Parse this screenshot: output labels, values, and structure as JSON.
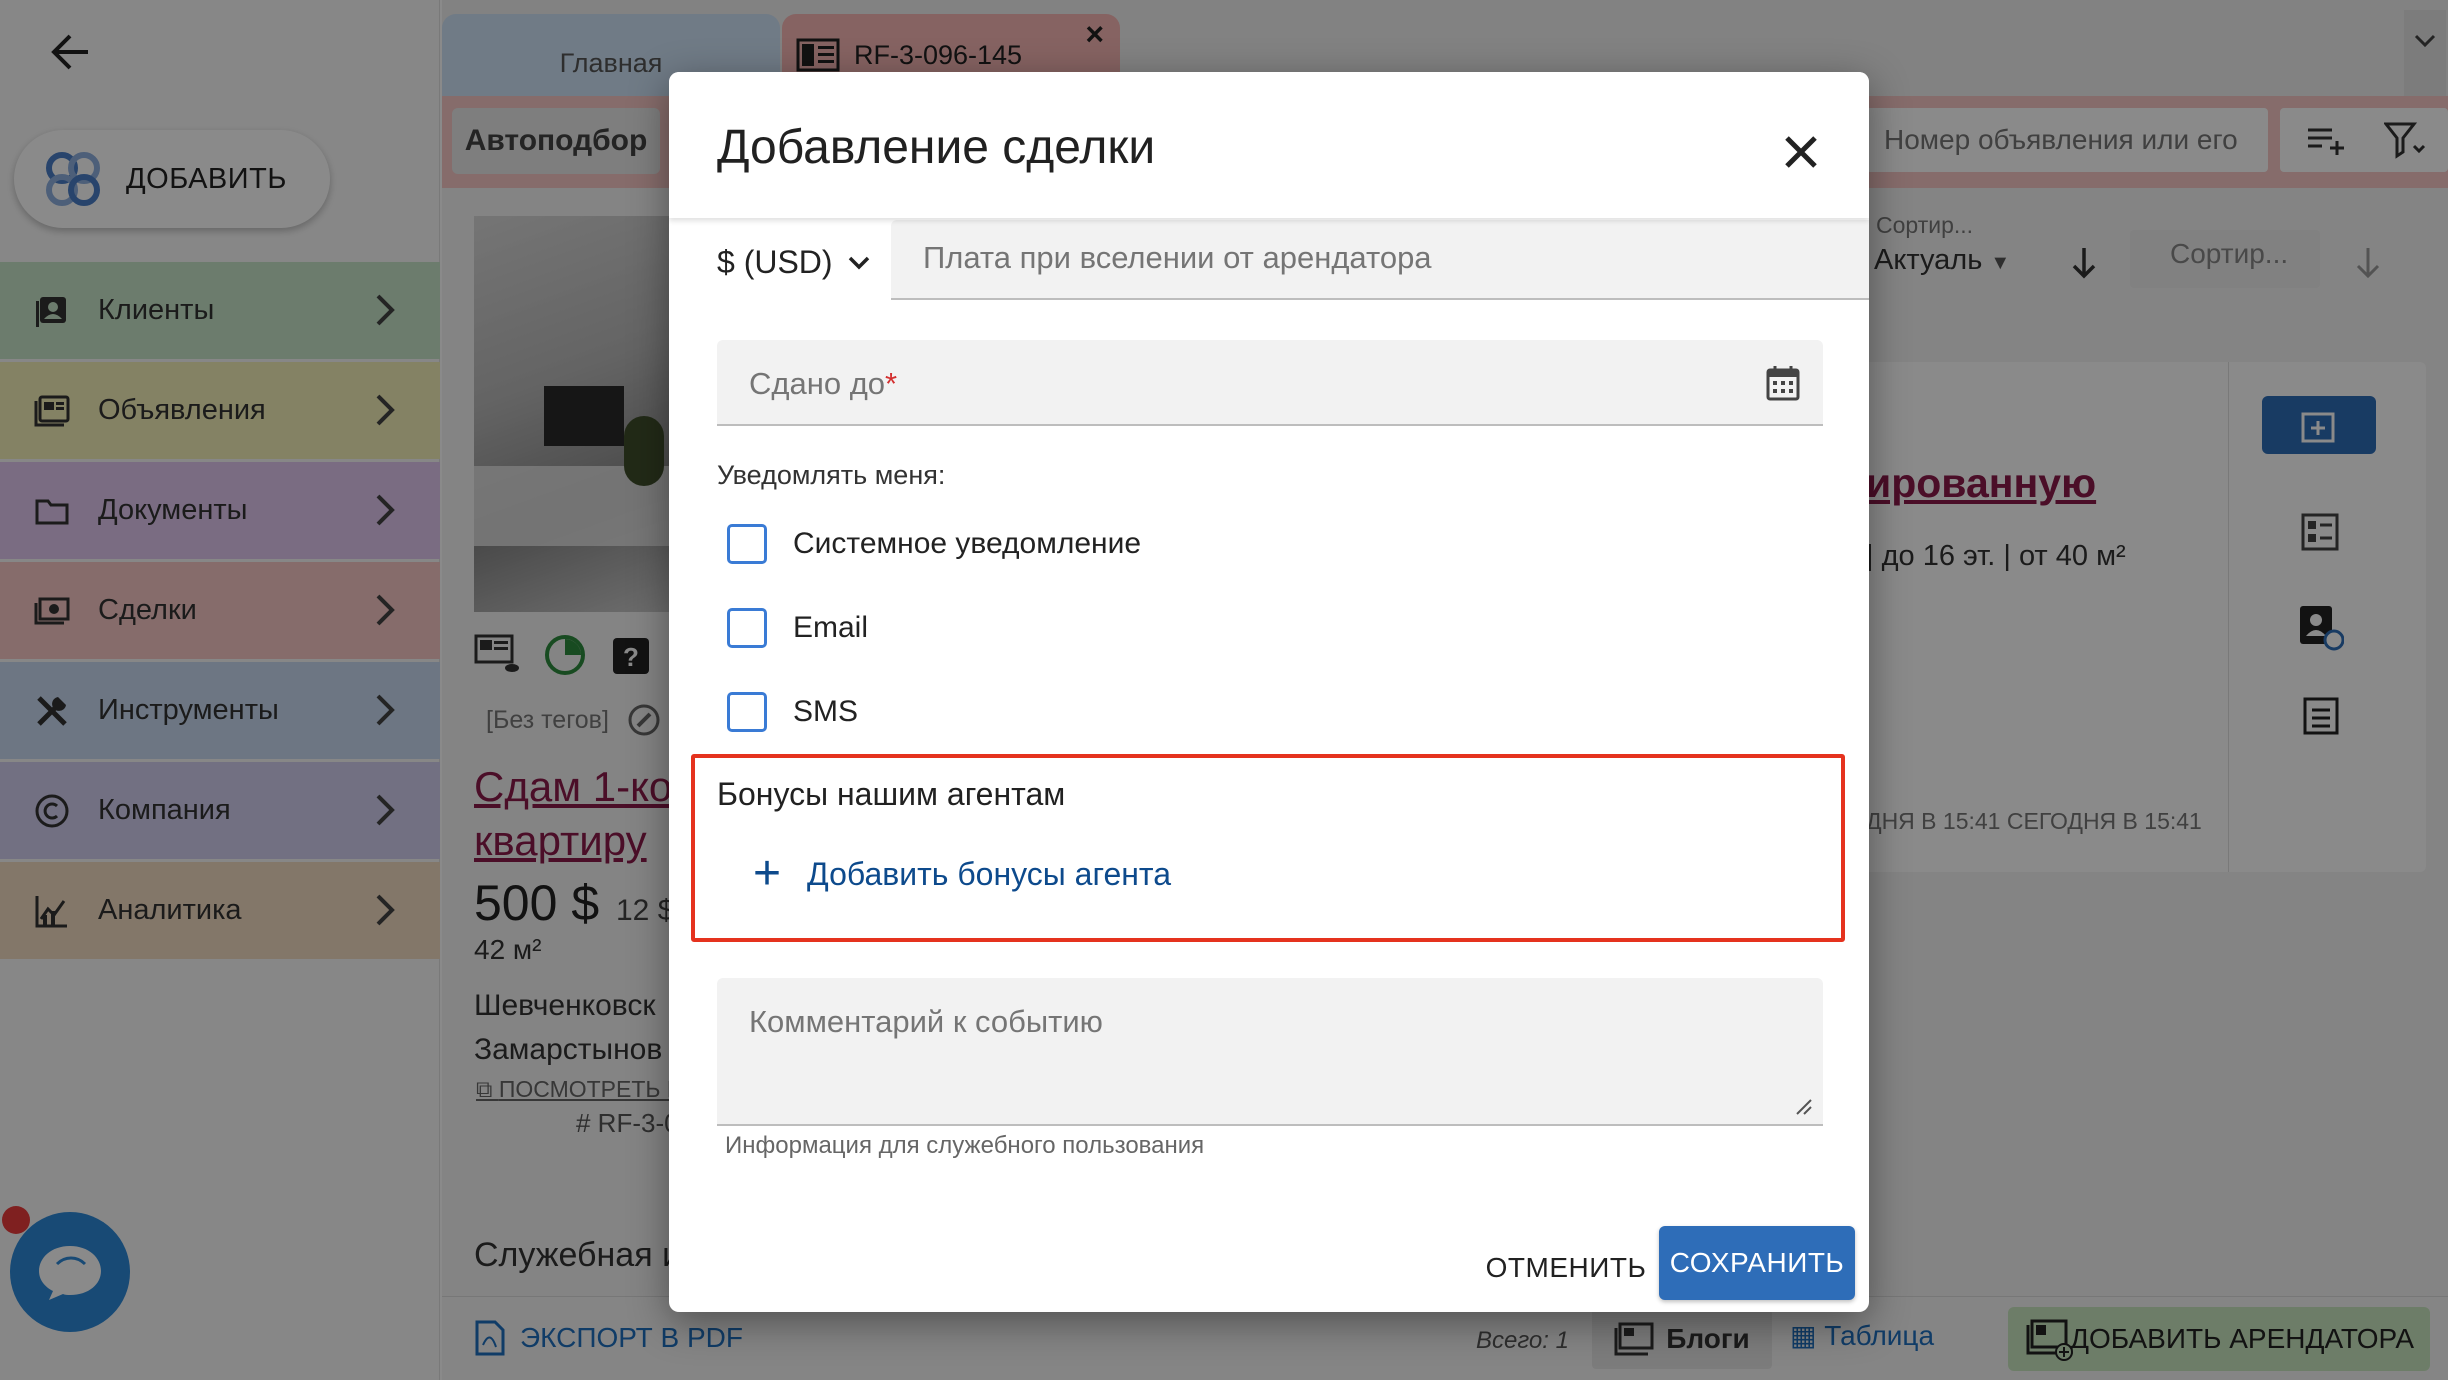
{
  "sidebar": {
    "add_label": "ДОБАВИТЬ",
    "items": [
      {
        "label": "Клиенты",
        "color": "#c8e6c9"
      },
      {
        "label": "Объявления",
        "color": "#f4f1b9"
      },
      {
        "label": "Документы",
        "color": "#e1c8f0"
      },
      {
        "label": "Сделки",
        "color": "#f7c8c6"
      },
      {
        "label": "Инструменты",
        "color": "#c9dbf2"
      },
      {
        "label": "Компания",
        "color": "#d2cff0"
      },
      {
        "label": "Аналитика",
        "color": "#f3dcc2"
      }
    ]
  },
  "tabs": {
    "home": "Главная",
    "current": "RF-3-096-145"
  },
  "toolbar": {
    "autopick": "Автоподбор",
    "search_placeholder": "Номер объявления или его"
  },
  "listing": {
    "tags": "[Без тегов]",
    "title_line1": "Сдам 1-ко",
    "title_line2": "квартиру",
    "price": "500 $",
    "price_sub": "12 $",
    "area": "42 м²",
    "addr_line1": "Шевченковск",
    "addr_line2": "Замарстынов",
    "view_link": "ПОСМОТРЕТЬ Н",
    "ref": "# RF-3-0",
    "service_title": "Служебная и"
  },
  "right_card": {
    "sort_label": "Сортир...",
    "sort_value": "Актуаль",
    "sort2": "Сортир...",
    "title": "ированную",
    "subtitle": "| до 16 эт. | от 40 м²",
    "dates": "ДНЯ В 15:41   СЕГОДНЯ В 15:41"
  },
  "footer": {
    "export_pdf": "ЭКСПОРТ В PDF",
    "total": "Всего: 1",
    "blogs": "Блоги",
    "table": "Таблица",
    "add_tenant": "ДОБАВИТЬ АРЕНДАТОРА"
  },
  "dialog": {
    "title": "Добавление сделки",
    "currency": "$ (USD)",
    "payment_placeholder": "Плата при вселении от арендатора",
    "rented_until_placeholder": "Сдано до",
    "required_mark": "*",
    "notify_label": "Уведомлять меня:",
    "checkboxes": [
      "Системное уведомление",
      "Email",
      "SMS"
    ],
    "bonus_title": "Бонусы нашим агентам",
    "bonus_add": "Добавить бонусы агента",
    "comment_placeholder": "Комментарий к событию",
    "comment_hint": "Информация для служебного пользования",
    "cancel": "ОТМЕНИТЬ",
    "save": "СОХРАНИТЬ"
  },
  "colors": {
    "accent": "#2e6db8",
    "highlight": "#e5321e",
    "link": "#0d4a8c"
  }
}
